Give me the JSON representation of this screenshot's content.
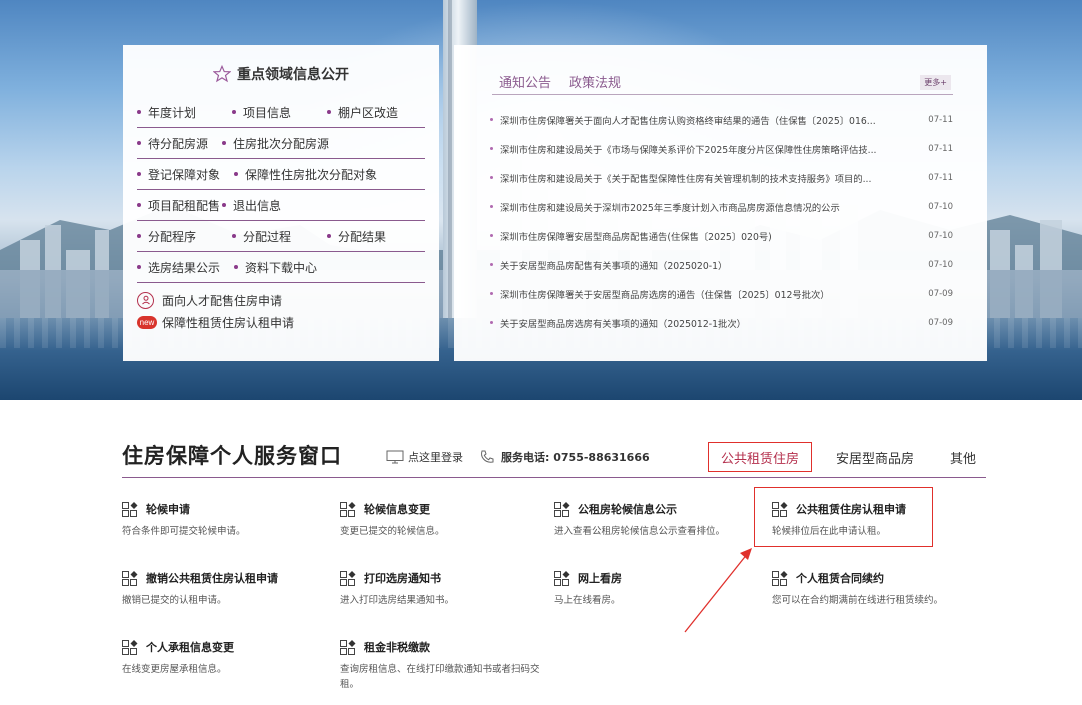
{
  "hero": {
    "focus_panel": {
      "title": "重点领域信息公开",
      "rows": [
        [
          "年度计划",
          "项目信息",
          "棚户区改造"
        ],
        [
          "待分配房源",
          "住房批次分配房源"
        ],
        [
          "登记保障对象",
          "保障性住房批次分配对象"
        ],
        [
          "项目配租配售",
          "退出信息"
        ],
        [
          "分配程序",
          "分配过程",
          "分配结果"
        ],
        [
          "选房结果公示",
          "资料下载中心"
        ]
      ],
      "special_links": [
        "面向人才配售住房申请",
        "保障性租赁住房认租申请"
      ]
    },
    "news_panel": {
      "tabs": [
        "通知公告",
        "政策法规"
      ],
      "more_label": "更多+",
      "items": [
        {
          "text": "深圳市住房保障署关于面向人才配售住房认购资格终审结果的通告（住保售〔2025〕016...",
          "date": "07-11"
        },
        {
          "text": "深圳市住房和建设局关于《市场与保障关系评价下2025年度分片区保障性住房策略评估技...",
          "date": "07-11"
        },
        {
          "text": "深圳市住房和建设局关于《关于配售型保障性住房有关管理机制的技术支持服务》项目的...",
          "date": "07-11"
        },
        {
          "text": "深圳市住房和建设局关于深圳市2025年三季度计划入市商品房房源信息情况的公示",
          "date": "07-10"
        },
        {
          "text": "深圳市住房保障署安居型商品房配售通告(住保售〔2025〕020号)",
          "date": "07-10"
        },
        {
          "text": "关于安居型商品房配售有关事项的通知（2025020-1）",
          "date": "07-10"
        },
        {
          "text": "深圳市住房保障署关于安居型商品房选房的通告（住保售〔2025〕012号批次）",
          "date": "07-09"
        },
        {
          "text": "关于安居型商品房选房有关事项的通知（2025012-1批次）",
          "date": "07-09"
        }
      ]
    }
  },
  "service": {
    "title": "住房保障个人服务窗口",
    "login_label": "点这里登录",
    "phone_label": "服务电话: 0755-88631666",
    "tabs": [
      "公共租赁住房",
      "安居型商品房",
      "其他"
    ],
    "cards": [
      {
        "title": "轮候申请",
        "desc": "符合条件即可提交轮候申请。"
      },
      {
        "title": "轮候信息变更",
        "desc": "变更已提交的轮候信息。"
      },
      {
        "title": "公租房轮候信息公示",
        "desc": "进入查看公租房轮候信息公示查看排位。"
      },
      {
        "title": "公共租赁住房认租申请",
        "desc": "轮候排位后在此申请认租。"
      },
      {
        "title": "撤销公共租赁住房认租申请",
        "desc": "撤销已提交的认租申请。"
      },
      {
        "title": "打印选房通知书",
        "desc": "进入打印选房结果通知书。"
      },
      {
        "title": "网上看房",
        "desc": "马上在线看房。"
      },
      {
        "title": "个人租赁合同续约",
        "desc": "您可以在合约期满前在线进行租赁续约。"
      },
      {
        "title": "个人承租信息变更",
        "desc": "在线变更房屋承租信息。"
      },
      {
        "title": "租金非税缴款",
        "desc": "查询房租信息、在线打印缴款通知书或者扫码交租。"
      }
    ]
  },
  "colors": {
    "accent_purple": "#8a5a8e",
    "highlight_red": "#e0302c",
    "active_tab_text": "#b4304d"
  },
  "icons": {
    "star": "star-outline-icon",
    "login": "monitor-icon",
    "phone": "phone-icon",
    "card": "grid-icon",
    "person_circle": "person-circle-icon",
    "new_badge": "new-badge-icon"
  }
}
